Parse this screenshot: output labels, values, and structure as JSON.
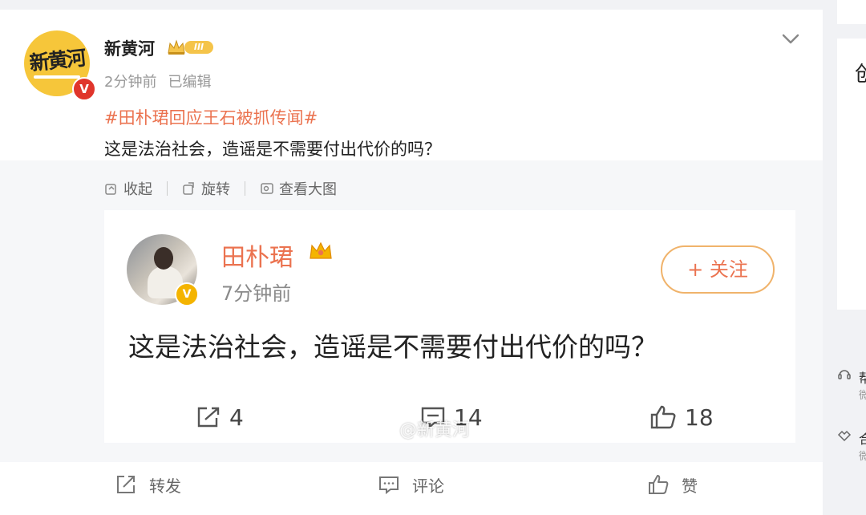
{
  "post": {
    "author": "新黄河",
    "avatar_logo": "新黄河",
    "level_badge": "III",
    "time": "2分钟前",
    "edited": "已编辑",
    "hashtag": "#田朴珺回应王石被抓传闻#",
    "text": "这是法治社会，造谣是不需要付出代价的吗？"
  },
  "toolbar": {
    "collapse": "收起",
    "rotate": "旋转",
    "view_large": "查看大图"
  },
  "screenshot": {
    "author": "田朴珺",
    "time": "7分钟前",
    "follow": "+ 关注",
    "text": "这是法治社会，造谣是不需要付出代价的吗？",
    "reposts": "4",
    "comments": "14",
    "likes": "18",
    "watermark": "@新黄河"
  },
  "actions": {
    "repost": "转发",
    "comment": "评论",
    "like": "赞"
  },
  "sidebar": {
    "panel_fragment": "创",
    "item1_title": "帮",
    "item1_sub": "微",
    "item2_title": "合",
    "item2_sub": "微"
  },
  "colors": {
    "accent": "#eb7350",
    "verified_red": "#e0352b",
    "verified_gold": "#f4b400",
    "avatar_yellow": "#f6c63a"
  },
  "icons": [
    "crown-icon",
    "chevron-down-icon",
    "collapse-icon",
    "rotate-icon",
    "view-large-icon",
    "repost-icon",
    "comment-icon",
    "like-icon",
    "verified-icon"
  ]
}
